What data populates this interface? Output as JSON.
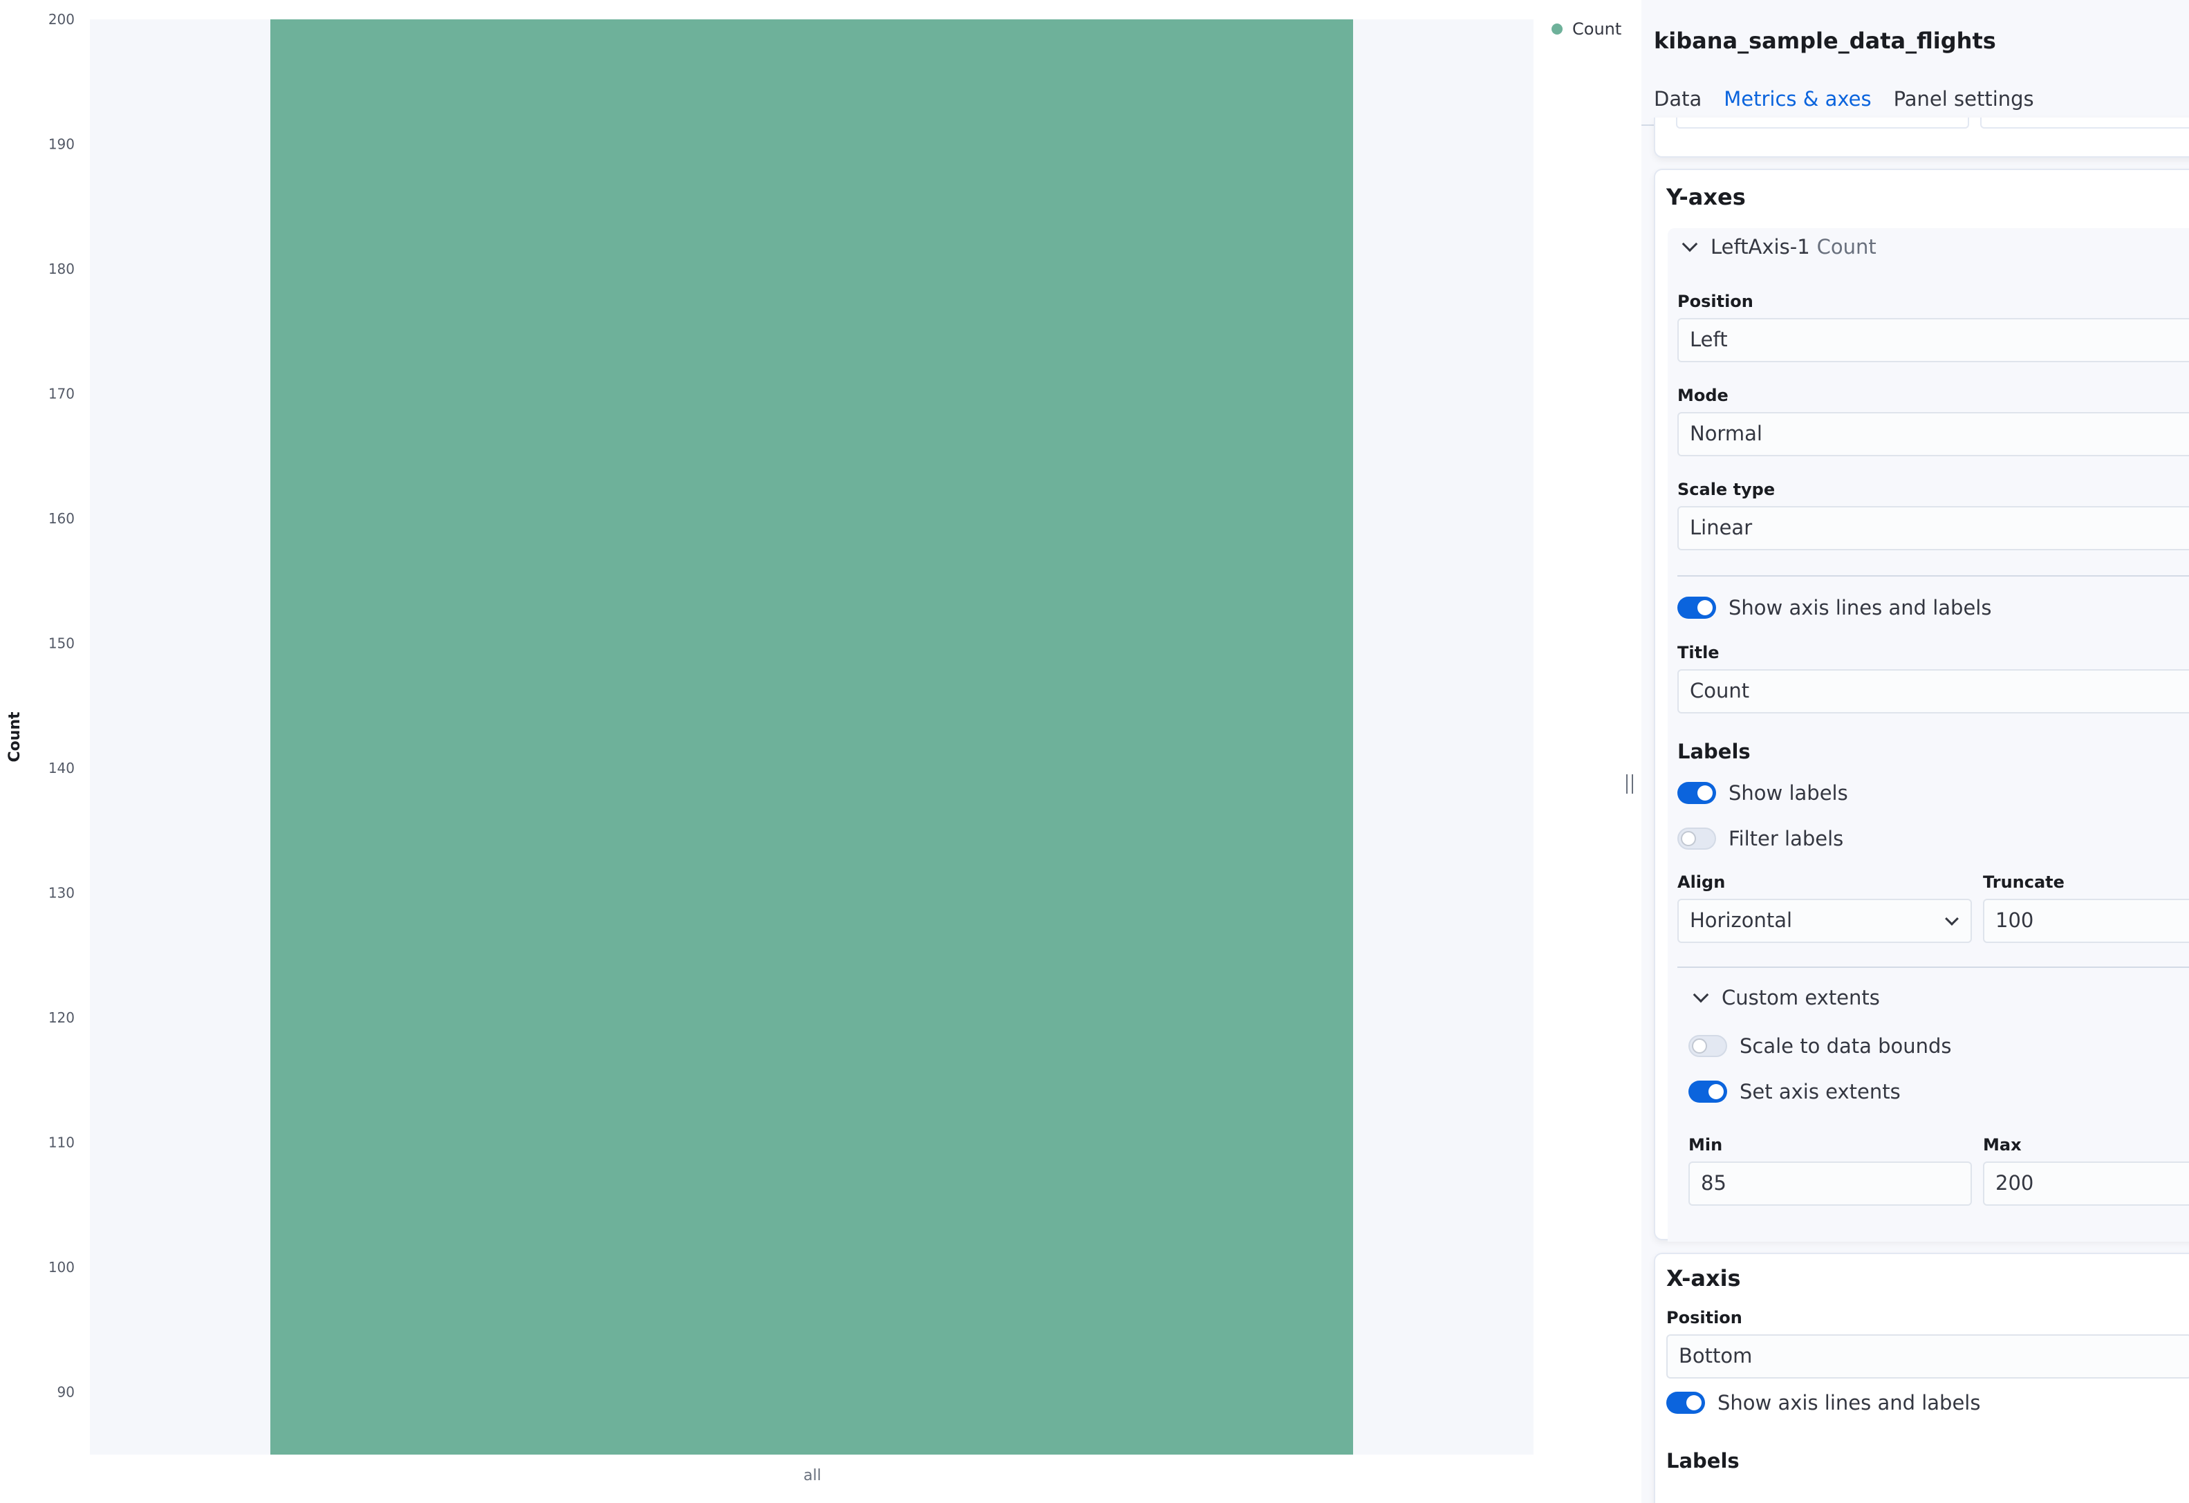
{
  "chart_data": {
    "type": "bar",
    "categories": [
      "all"
    ],
    "series": [
      {
        "name": "Count",
        "values": [
          200
        ]
      }
    ],
    "ylabel": "Count",
    "xlabel": "",
    "ylim": [
      85,
      200
    ],
    "yticks": [
      90,
      100,
      110,
      120,
      130,
      140,
      150,
      160,
      170,
      180,
      190,
      200
    ],
    "x_tick_label": "all",
    "legend": {
      "label": "Count",
      "position": "top-right"
    },
    "grid": false
  },
  "colors": {
    "bar": "#6eb19a",
    "plot_background": "#f5f7fb",
    "accent": "#0b64dd"
  },
  "panel": {
    "title": "kibana_sample_data_flights",
    "tabs": [
      "Data",
      "Metrics & axes",
      "Panel settings"
    ],
    "active_tab": "Metrics & axes"
  },
  "y_axes": {
    "section_title": "Y-axes",
    "axis_name": "LeftAxis-1",
    "axis_series": "Count",
    "position_label": "Position",
    "position_value": "Left",
    "mode_label": "Mode",
    "mode_value": "Normal",
    "scale_type_label": "Scale type",
    "scale_type_value": "Linear",
    "show_axis_lines_label": "Show axis lines and labels",
    "show_axis_lines": true,
    "title_label": "Title",
    "title_value": "Count",
    "labels_title": "Labels",
    "show_labels_label": "Show labels",
    "show_labels": true,
    "filter_labels_label": "Filter labels",
    "filter_labels": false,
    "align_label": "Align",
    "align_value": "Horizontal",
    "truncate_label": "Truncate",
    "truncate_value": "100",
    "custom_extents_label": "Custom extents",
    "scale_to_bounds_label": "Scale to data bounds",
    "scale_to_bounds": false,
    "set_extents_label": "Set axis extents",
    "set_extents": true,
    "min_label": "Min",
    "min_value": "85",
    "max_label": "Max",
    "max_value": "200"
  },
  "x_axis": {
    "section_title": "X-axis",
    "position_label": "Position",
    "position_value": "Bottom",
    "show_axis_lines_label": "Show axis lines and labels",
    "show_axis_lines": true,
    "labels_title": "Labels"
  }
}
